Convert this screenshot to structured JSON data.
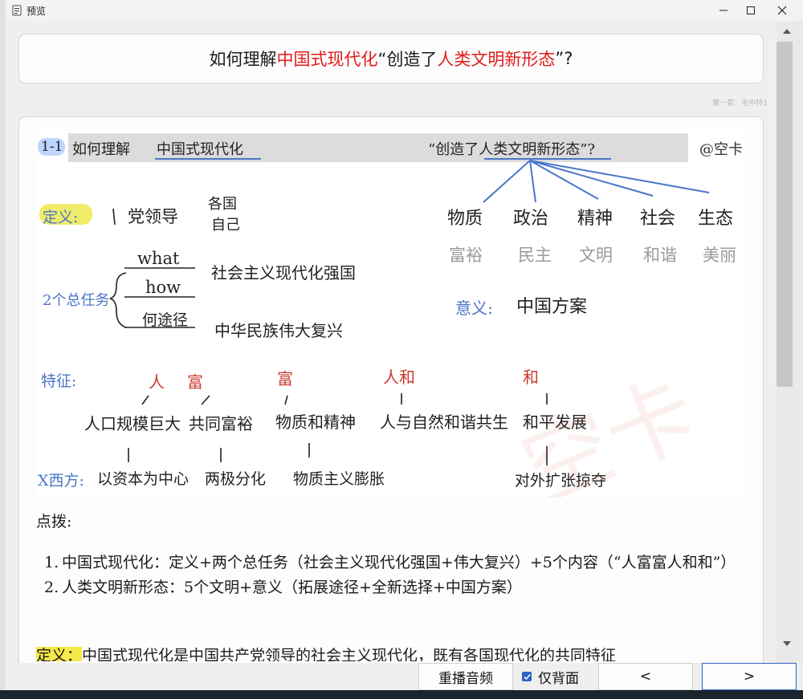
{
  "window": {
    "title": "预览"
  },
  "question": {
    "prefix": "如何理解",
    "red1": "中国式现代化",
    "mid": "“创造了",
    "red2": "人类文明新形态",
    "suffix": "”?"
  },
  "source_tag": "第一套：毛中特1",
  "note_image": {
    "header_index": "1-1",
    "header_prefix": "如何理解",
    "header_subject": "中国式现代化",
    "header_quote": "“创造了人类文明新形态”?",
    "author": "@空卡",
    "definition_label": "定义:",
    "definition_text": "党领导",
    "definition_branch_1": "各国",
    "definition_branch_2": "自己",
    "tasks_label": "2个总任务",
    "task_what": "what",
    "task_how": "how",
    "task_path": "何途径",
    "task_goal_1": "社会主义现代化强国",
    "task_goal_2": "中华民族伟大复兴",
    "civilizations": [
      "物质",
      "政治",
      "精神",
      "社会",
      "生态"
    ],
    "civilization_traits": [
      "富裕",
      "民主",
      "文明",
      "和谐",
      "美丽"
    ],
    "meaning_label": "意义:",
    "meaning_text": "中国方案",
    "features_label": "特征:",
    "feature_marks": [
      "人",
      "富",
      "富",
      "人和",
      "和"
    ],
    "features": [
      "人口规模巨大",
      "共同富裕",
      "物质和精神",
      "人与自然和谐共生",
      "和平发展"
    ],
    "contrast_label": "X西方:",
    "contrasts": [
      "以资本为中心",
      "两极分化",
      "物质主义膨胀",
      "对外扩张掠夺"
    ],
    "watermark": "空卡"
  },
  "tips": {
    "heading": "点拨:",
    "items": [
      {
        "num": "1.",
        "text": "中国式现代化：定义+两个总任务（社会主义现代化强国+伟大复兴）+5个内容（“人富富人和和”）"
      },
      {
        "num": "2.",
        "text": "人类文明新形态：5个文明+意义（拓展途径+全新选择+中国方案）"
      }
    ],
    "def_label": "定义：",
    "def_text": "中国式现代化是中国共产党领导的社会主义现代化，既有各国现代化的共同特征"
  },
  "controls": {
    "replay_label": "重播音频",
    "back_only_label": "仅背面",
    "back_only_checked": true,
    "prev_label": "<",
    "next_label": ">"
  }
}
